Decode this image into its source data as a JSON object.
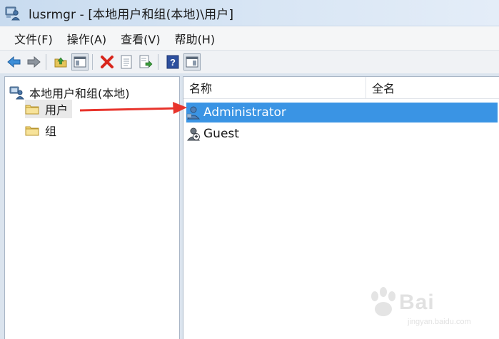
{
  "window": {
    "title": "lusrmgr - [本地用户和组(本地)\\用户]",
    "icon": "users-management-icon"
  },
  "menu": {
    "items": [
      {
        "label": "文件(F)"
      },
      {
        "label": "操作(A)"
      },
      {
        "label": "查看(V)"
      },
      {
        "label": "帮助(H)"
      }
    ]
  },
  "toolbar": {
    "buttons": [
      {
        "icon": "back-arrow-icon"
      },
      {
        "icon": "forward-arrow-icon"
      },
      {
        "icon": "up-folder-icon"
      },
      {
        "icon": "show-hide-console-tree-icon"
      },
      {
        "icon": "delete-icon"
      },
      {
        "icon": "properties-icon"
      },
      {
        "icon": "export-list-icon"
      },
      {
        "icon": "help-icon"
      },
      {
        "icon": "show-hide-action-pane-icon"
      }
    ]
  },
  "tree": {
    "root_label": "本地用户和组(本地)",
    "nodes": [
      {
        "label": "用户",
        "selected": true
      },
      {
        "label": "组",
        "selected": false
      }
    ]
  },
  "list": {
    "columns": [
      "名称",
      "全名"
    ],
    "rows": [
      {
        "name": "Administrator",
        "fullname": "",
        "selected": true
      },
      {
        "name": "Guest",
        "fullname": "",
        "selected": false
      }
    ]
  },
  "watermark": {
    "text": "Bai",
    "sub": "jingyan.baidu.com"
  },
  "colors": {
    "selection": "#3a94e4",
    "annotation_arrow": "#e8342c"
  }
}
